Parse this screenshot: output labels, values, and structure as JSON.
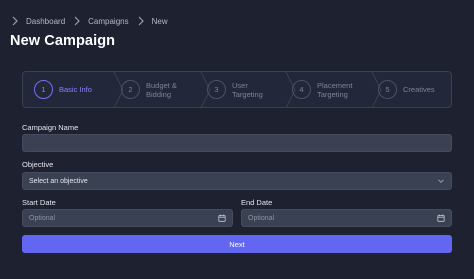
{
  "breadcrumb": [
    "Dashboard",
    "Campaigns",
    "New"
  ],
  "page_title": "New Campaign",
  "stepper": {
    "active_step": 1,
    "steps": [
      {
        "number": "1",
        "label": "Basic Info"
      },
      {
        "number": "2",
        "label": "Budget & Bidding"
      },
      {
        "number": "3",
        "label": "User Targeting"
      },
      {
        "number": "4",
        "label": "Placement Targeting"
      },
      {
        "number": "5",
        "label": "Creatives"
      }
    ]
  },
  "form": {
    "campaign_name": {
      "label": "Campaign Name",
      "value": ""
    },
    "objective": {
      "label": "Objective",
      "value": "Select an objective"
    },
    "start_date": {
      "label": "Start Date",
      "placeholder": "Optional"
    },
    "end_date": {
      "label": "End Date",
      "placeholder": "Optional"
    }
  },
  "next_button_label": "Next",
  "colors": {
    "background": "#1e2230",
    "accent": "#6366f1",
    "active_step": "#8a80ff",
    "input_background": "#3a4152"
  }
}
